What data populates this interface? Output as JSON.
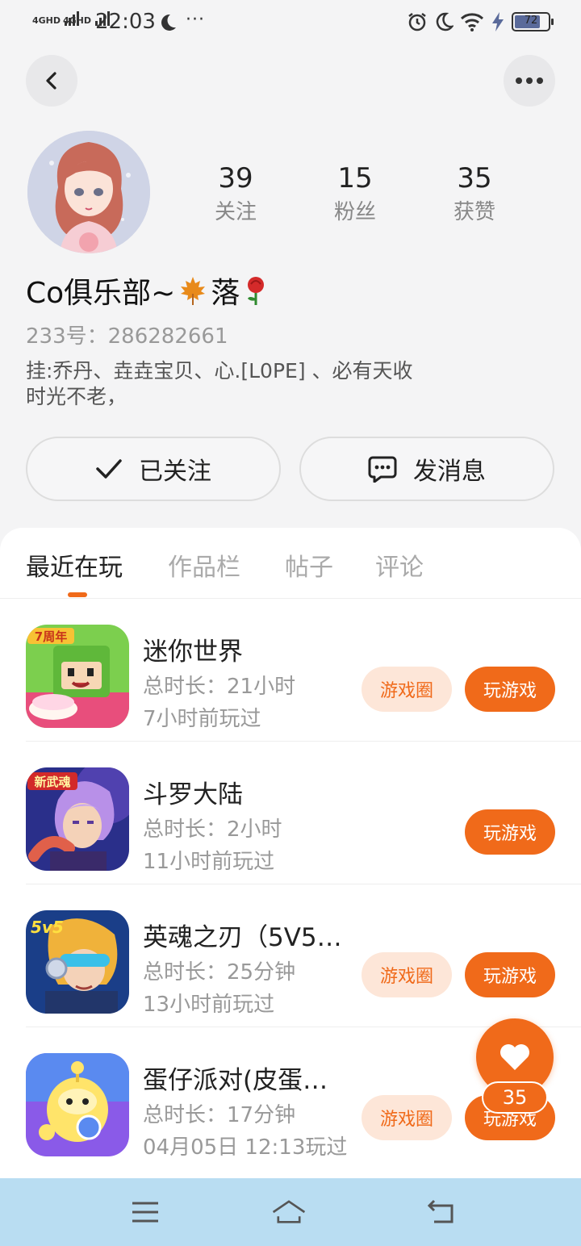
{
  "status_bar": {
    "signal1": "4GHD",
    "signal2": "4GHD",
    "time": "22:03",
    "overflow": "···",
    "battery": "72"
  },
  "profile": {
    "stats": [
      {
        "value": "39",
        "label": "关注"
      },
      {
        "value": "15",
        "label": "粉丝"
      },
      {
        "value": "35",
        "label": "获赞"
      }
    ],
    "nickname": "Co俱乐部~",
    "nickname_suffix": "落",
    "uid": "233号：286282661",
    "bio_line1": "挂:乔丹、垚垚宝贝、心.[L0PE] 、必有天收",
    "bio_line2": "时光不老，"
  },
  "actions": {
    "follow_label": "已关注",
    "message_label": "发消息"
  },
  "tabs": [
    "最近在玩",
    "作品栏",
    "帖子",
    "评论"
  ],
  "games": [
    {
      "name": "迷你世界",
      "duration": "总时长：21小时",
      "last_played": "7小时前玩过",
      "circle": "游戏圈",
      "play": "玩游戏"
    },
    {
      "name": "斗罗大陆",
      "duration": "总时长：2小时",
      "last_played": "11小时前玩过",
      "circle": "",
      "play": "玩游戏"
    },
    {
      "name": "英魂之刃（5V5…",
      "duration": "总时长：25分钟",
      "last_played": "13小时前玩过",
      "circle": "游戏圈",
      "play": "玩游戏"
    },
    {
      "name": "蛋仔派对(皮蛋…",
      "duration": "总时长：17分钟",
      "last_played": "04月05日 12:13玩过",
      "circle": "游戏圈",
      "play": "玩游戏"
    }
  ],
  "game_icon_badges": [
    "7周年",
    "新武魂",
    "5v5",
    ""
  ],
  "like_fab": {
    "count": "35"
  },
  "colors": {
    "accent": "#f06a1a",
    "accent_light": "#fde6d8",
    "nav_bg": "#b9ddf2"
  }
}
